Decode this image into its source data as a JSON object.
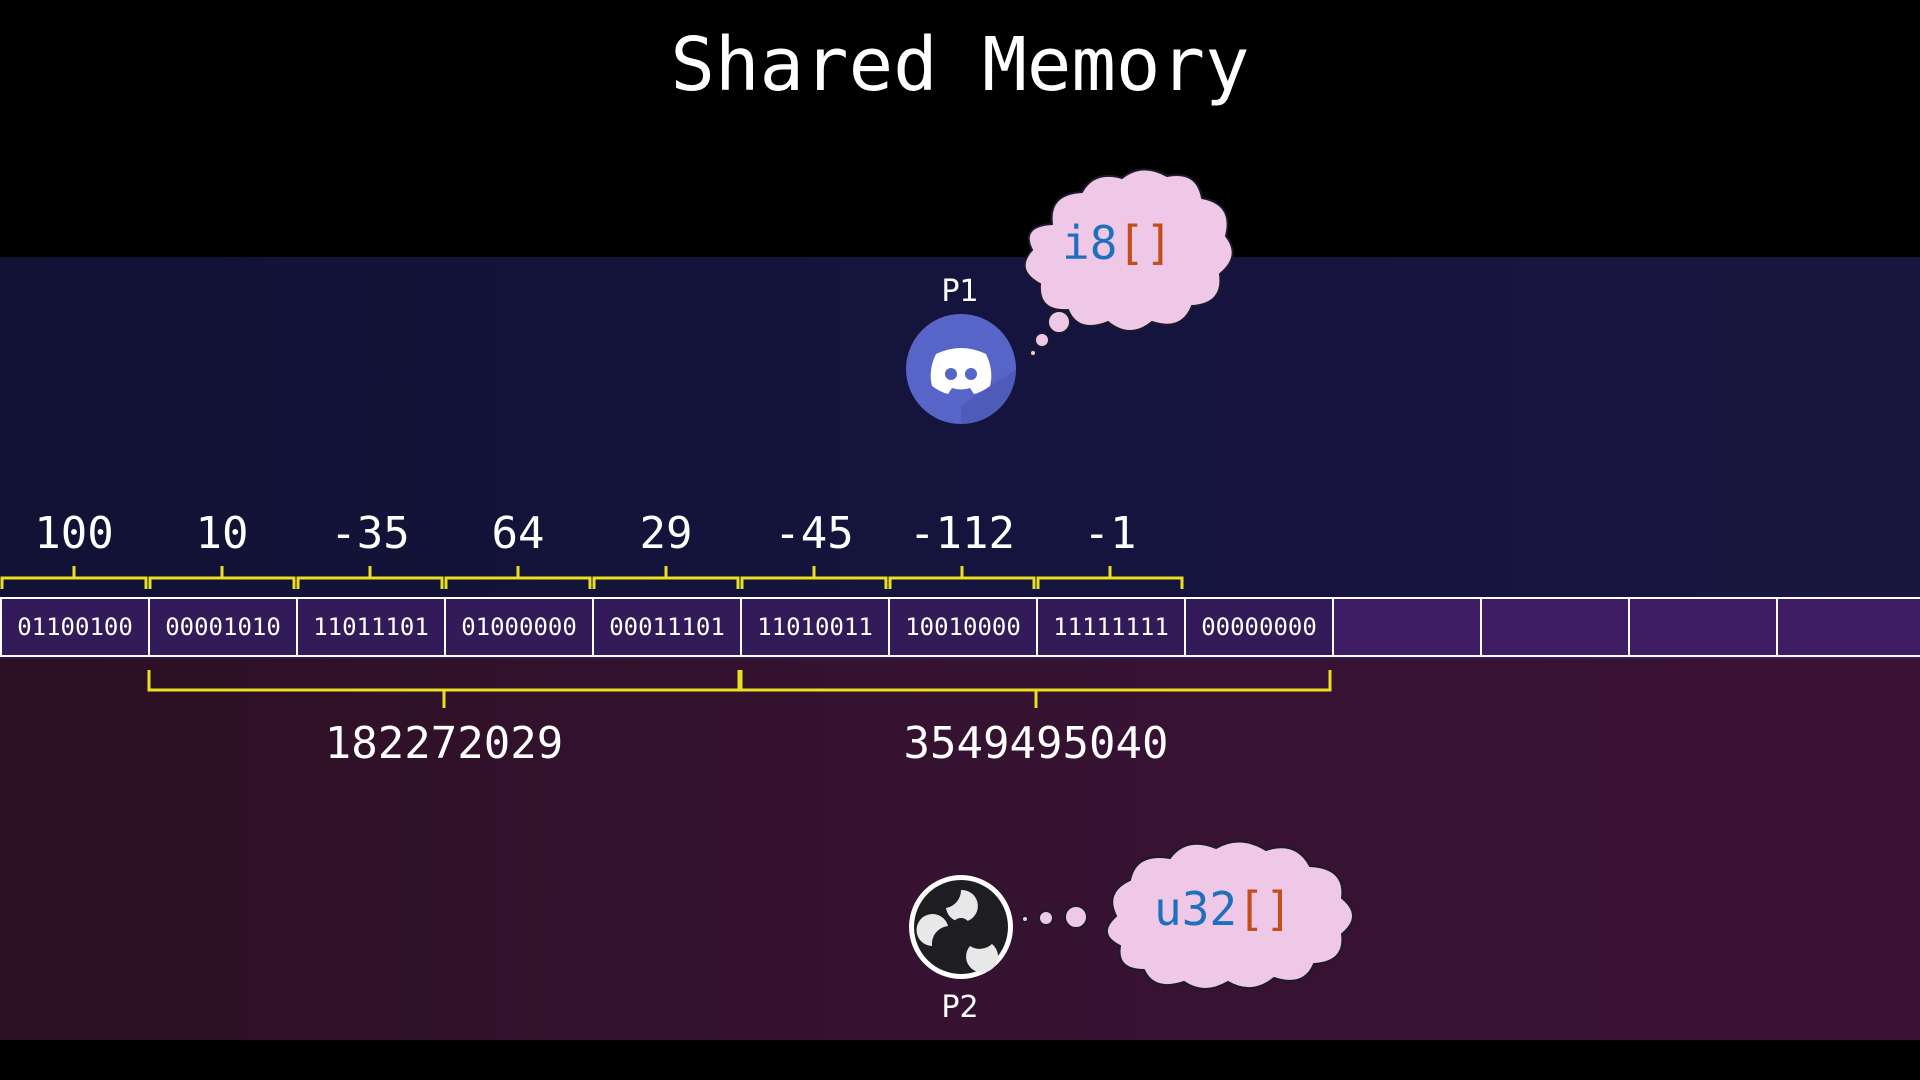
{
  "title": "Shared Memory",
  "processes": {
    "p1": {
      "label": "P1",
      "type_name": "i8",
      "type_brackets": "[]",
      "icon": "discord-icon"
    },
    "p2": {
      "label": "P2",
      "type_name": "u32",
      "type_brackets": "[]",
      "icon": "obs-icon"
    }
  },
  "memory": {
    "bytes": [
      "01100100",
      "00001010",
      "11011101",
      "01000000",
      "00011101",
      "11010011",
      "10010000",
      "11111111",
      "00000000",
      "",
      "",
      "",
      ""
    ]
  },
  "i8_values": [
    "100",
    "10",
    "-35",
    "64",
    "29",
    "-45",
    "-112",
    "-1"
  ],
  "u32_values": [
    "182272029",
    "3549495040"
  ],
  "colors": {
    "bracket": "#e8e020",
    "type_name": "#1f6fbf",
    "type_brackets": "#c24e1c",
    "cloud": "#efc8e8"
  }
}
